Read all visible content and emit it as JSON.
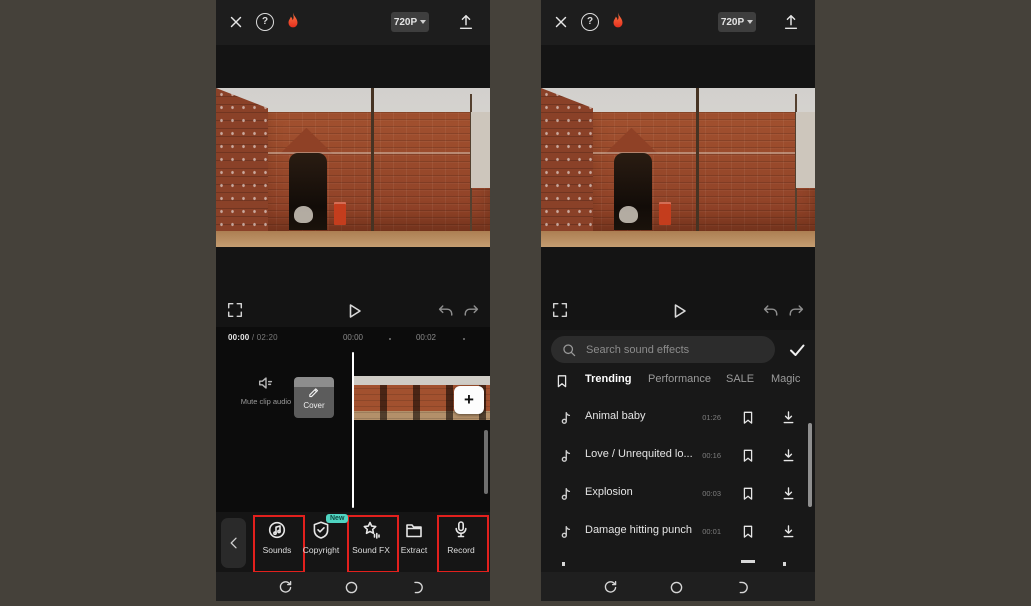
{
  "colors": {
    "canvas_background": "#45413A",
    "highlight_red": "#E2201D",
    "badge_teal": "#4FD4C1"
  },
  "icons": {
    "help_glyph": "?"
  },
  "top_bar": {
    "resolution": "720P"
  },
  "left_phone": {
    "timeline": {
      "elapsed_current": "00:00",
      "elapsed_total": "/ 02:20",
      "ruler_ticks": [
        "00:00",
        "00:02"
      ],
      "mute_label": "Mute clip audio",
      "cover_label": "Cover",
      "add_clip_label": "+"
    },
    "toolbar": {
      "items": [
        {
          "label": "Sounds",
          "highlighted": true
        },
        {
          "label": "Copyright",
          "highlighted": false,
          "badge": "New"
        },
        {
          "label": "Sound FX",
          "highlighted": true
        },
        {
          "label": "Extract",
          "highlighted": false
        },
        {
          "label": "Record",
          "highlighted": true
        }
      ]
    }
  },
  "right_phone": {
    "search": {
      "placeholder": "Search sound effects"
    },
    "tabs": {
      "selected": "Trending",
      "items": [
        {
          "label": "Trending"
        },
        {
          "label": "Performance"
        },
        {
          "label": "SALE"
        },
        {
          "label": "Magic"
        }
      ]
    },
    "sound_list": [
      {
        "name": "Animal baby",
        "duration": "01:26"
      },
      {
        "name": "Love / Unrequited lo...",
        "duration": "00:16"
      },
      {
        "name": "Explosion",
        "duration": "00:03"
      },
      {
        "name": "Damage hitting punch",
        "duration": "00:01"
      }
    ]
  }
}
